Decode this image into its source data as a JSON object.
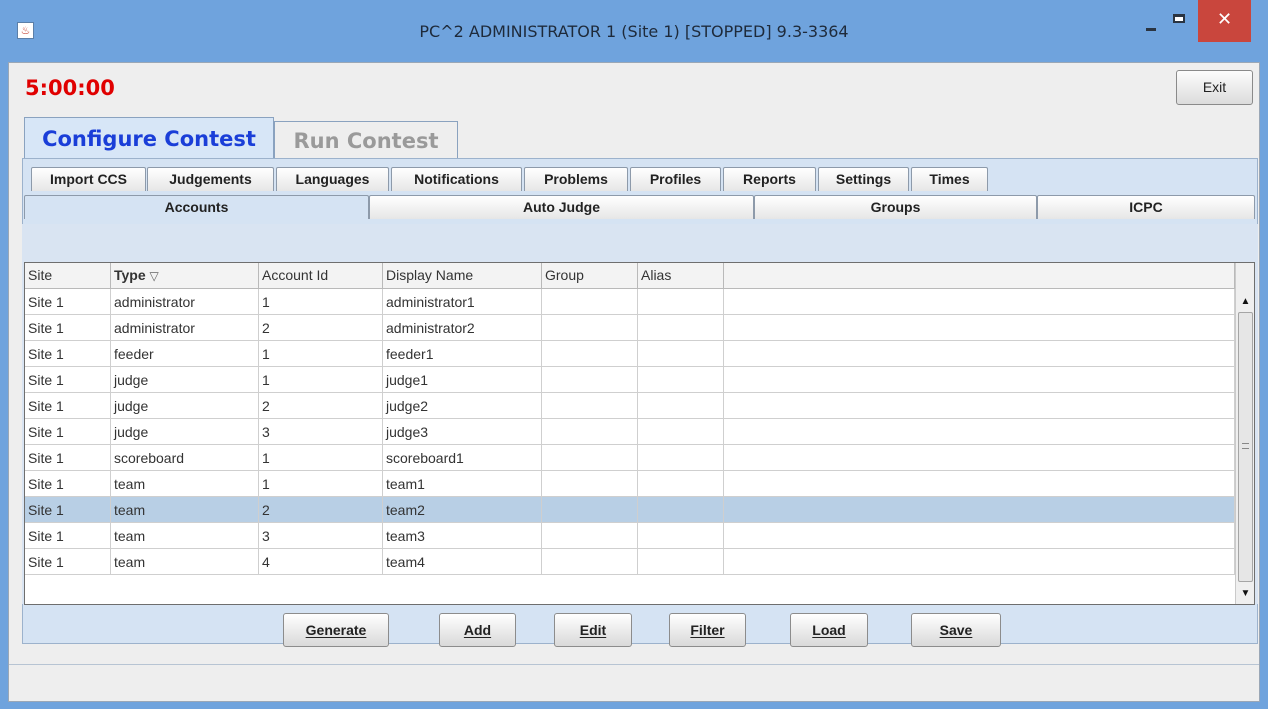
{
  "window": {
    "title": "PC^2 ADMINISTRATOR 1 (Site 1) [STOPPED] 9.3-3364",
    "app_icon": "java-coffee-icon",
    "close_glyph": "✕"
  },
  "clock": "5:00:00",
  "exit_button": "Exit",
  "main_tabs": [
    {
      "label": "Configure Contest",
      "active": true
    },
    {
      "label": "Run Contest",
      "active": false
    }
  ],
  "config_tabs_row1": [
    "Import CCS",
    "Judgements",
    "Languages",
    "Notifications",
    "Problems",
    "Profiles",
    "Reports",
    "Settings",
    "Times"
  ],
  "config_tabs_row2": [
    "Accounts",
    "Auto Judge",
    "Groups",
    "ICPC"
  ],
  "active_config_tab": "Accounts",
  "table": {
    "columns": [
      "Site",
      "Type",
      "Account Id",
      "Display Name",
      "Group",
      "Alias",
      ""
    ],
    "sort_indicator": "▽",
    "rows": [
      [
        "Site 1",
        "administrator",
        "1",
        "administrator1",
        "",
        ""
      ],
      [
        "Site 1",
        "administrator",
        "2",
        "administrator2",
        "",
        ""
      ],
      [
        "Site 1",
        "feeder",
        "1",
        "feeder1",
        "",
        ""
      ],
      [
        "Site 1",
        "judge",
        "1",
        "judge1",
        "",
        ""
      ],
      [
        "Site 1",
        "judge",
        "2",
        "judge2",
        "",
        ""
      ],
      [
        "Site 1",
        "judge",
        "3",
        "judge3",
        "",
        ""
      ],
      [
        "Site 1",
        "scoreboard",
        "1",
        "scoreboard1",
        "",
        ""
      ],
      [
        "Site 1",
        "team",
        "1",
        "team1",
        "",
        ""
      ],
      [
        "Site 1",
        "team",
        "2",
        "team2",
        "",
        ""
      ],
      [
        "Site 1",
        "team",
        "3",
        "team3",
        "",
        ""
      ],
      [
        "Site 1",
        "team",
        "4",
        "team4",
        "",
        ""
      ]
    ],
    "selected_row": 8
  },
  "action_buttons": [
    "Generate",
    "Add",
    "Edit",
    "Filter",
    "Load",
    "Save"
  ],
  "colors": {
    "clock": "#e00000",
    "active_tab_text": "#1a3ed8",
    "selected_row": "#b8cfe5",
    "title_bar": "#6fa3dd",
    "close_button": "#c9463d"
  }
}
